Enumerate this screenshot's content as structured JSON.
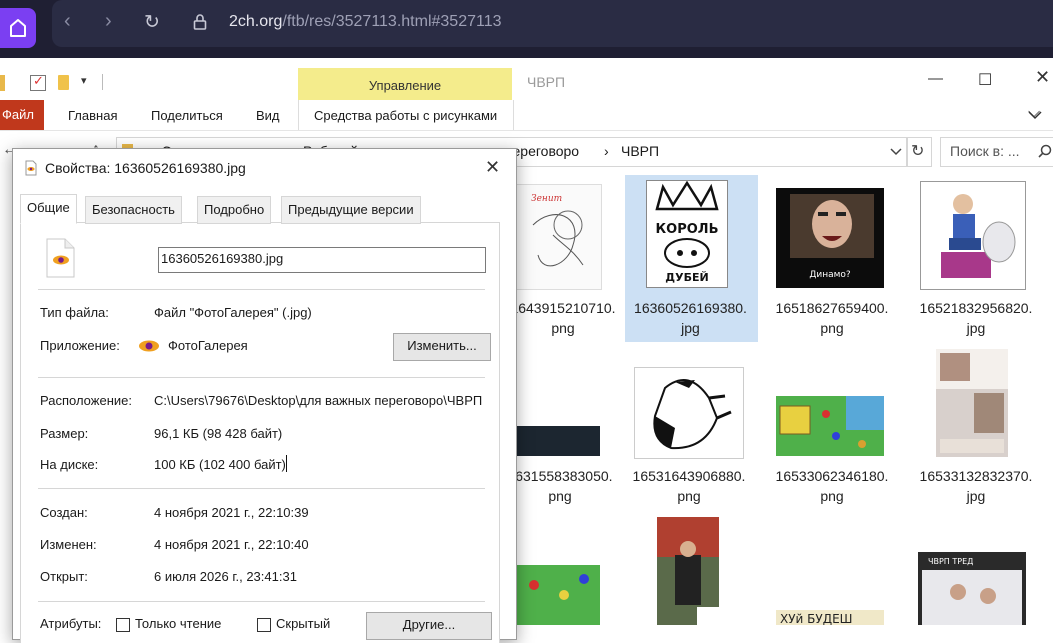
{
  "browser": {
    "url_domain": "2ch.org",
    "url_path": "/ftb/res/3527113.html#3527113",
    "colors": {
      "bg": "#1f1f33",
      "accent": "#7b3ff2"
    }
  },
  "explorer": {
    "ribbon_tabs": {
      "file": "Файл",
      "home": "Главная",
      "share": "Поделиться",
      "view": "Вид",
      "manage": "Управление",
      "picture_tools": "Средства работы с рисунками"
    },
    "window_title": "ЧВРП",
    "breadcrumb": [
      "Этот компьютер",
      "Рабочий стол",
      "для важных переговоро",
      "ЧВРП"
    ],
    "search_placeholder": "Поиск в: ...",
    "files": [
      {
        "name_line1": "1643915210710.",
        "name_line2": "png"
      },
      {
        "name_line1": "16360526169380.",
        "name_line2": "jpg",
        "selected": true
      },
      {
        "name_line1": "16518627659400.",
        "name_line2": "png"
      },
      {
        "name_line1": "16521832956820.",
        "name_line2": "jpg"
      },
      {
        "name_line1": "1631558383050.",
        "name_line2": "png"
      },
      {
        "name_line1": "16531643906880.",
        "name_line2": "png"
      },
      {
        "name_line1": "16533062346180.",
        "name_line2": "png"
      },
      {
        "name_line1": "16533132832370.",
        "name_line2": "jpg"
      }
    ],
    "thumb_texts": {
      "korol_top": "КОРОЛЬ",
      "korol_bottom": "ДУБЕЙ",
      "dinamo": "Динамо?",
      "hui_budesh": "ХУй  БУДЕШ",
      "chvrp_tred": "ЧВРП ТРЕД"
    }
  },
  "dialog": {
    "title": "Свойства: 16360526169380.jpg",
    "tabs": [
      "Общие",
      "Безопасность",
      "Подробно",
      "Предыдущие версии"
    ],
    "filename": "16360526169380.jpg",
    "rows": {
      "type_label": "Тип файла:",
      "type_value": "Файл \"ФотоГалерея\" (.jpg)",
      "app_label": "Приложение:",
      "app_value": "ФотоГалерея",
      "change_button": "Изменить...",
      "location_label": "Расположение:",
      "location_value": "C:\\Users\\79676\\Desktop\\для важных переговоро\\ЧВРП",
      "size_label": "Размер:",
      "size_value": "96,1 КБ (98 428 байт)",
      "disk_label": "На диске:",
      "disk_value": "100 КБ (102 400 байт)",
      "created_label": "Создан:",
      "created_value": "4 ноября 2021 г., 22:10:39",
      "modified_label": "Изменен:",
      "modified_value": "4 ноября 2021 г., 22:10:40",
      "opened_label": "Открыт:",
      "opened_value": "6 июля 2026 г., 23:41:31",
      "attrs_label": "Атрибуты:",
      "readonly_label": "Только чтение",
      "hidden_label": "Скрытый",
      "other_button": "Другие..."
    }
  }
}
